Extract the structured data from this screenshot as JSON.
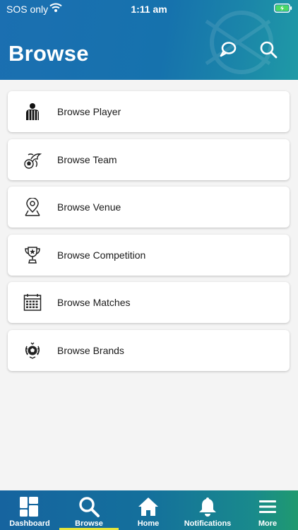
{
  "status_bar": {
    "carrier": "SOS only",
    "time": "1:11 am"
  },
  "header": {
    "title": "Browse",
    "chat_icon": "chat-bubble-icon",
    "search_icon": "search-icon"
  },
  "browse_items": [
    {
      "label": "Browse Player",
      "icon": "referee-player-icon"
    },
    {
      "label": "Browse Team",
      "icon": "team-dragon-ball-icon"
    },
    {
      "label": "Browse Venue",
      "icon": "map-pin-icon"
    },
    {
      "label": "Browse Competition",
      "icon": "trophy-icon"
    },
    {
      "label": "Browse Matches",
      "icon": "calendar-icon"
    },
    {
      "label": "Browse Brands",
      "icon": "ball-laurel-icon"
    }
  ],
  "tabbar": {
    "tabs": [
      {
        "label": "Dashboard",
        "icon": "dashboard-grid-icon"
      },
      {
        "label": "Browse",
        "icon": "search-icon",
        "active": true
      },
      {
        "label": "Home",
        "icon": "home-icon"
      },
      {
        "label": "Notifications",
        "icon": "bell-icon"
      },
      {
        "label": "More",
        "icon": "menu-icon"
      }
    ]
  },
  "colors": {
    "header": "#1672ad",
    "tabbar": "#14709c",
    "active_indicator": "#e6e63a",
    "background": "#f4f4f4"
  }
}
